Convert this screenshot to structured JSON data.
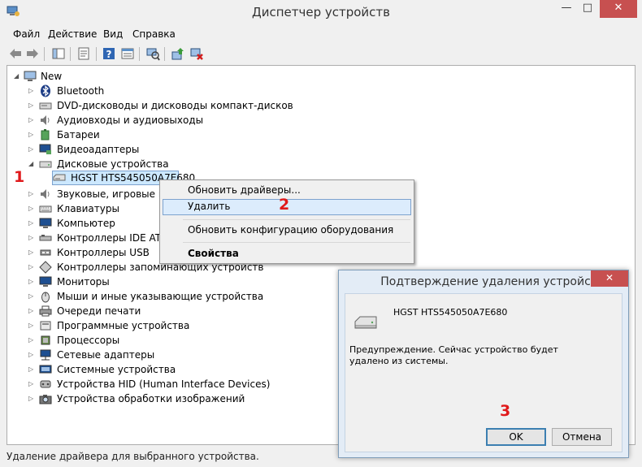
{
  "window": {
    "title": "Диспетчер устройств",
    "buttons": {
      "minimize": "—",
      "maximize": "□",
      "close": "✕"
    }
  },
  "menu": [
    "Файл",
    "Действие",
    "Вид",
    "Справка"
  ],
  "toolbar": [
    "back-arrow-icon",
    "forward-arrow-icon",
    "show-hide-tree-icon",
    "properties-icon",
    "help-icon",
    "view-icon",
    "scan-hardware-icon",
    "update-driver-icon",
    "uninstall-icon"
  ],
  "tree": {
    "root": "New",
    "items": [
      "Bluetooth",
      "DVD-дисководы и дисководы компакт-дисков",
      "Аудиовходы и аудиовыходы",
      "Батареи",
      "Видеоадаптеры",
      "Дисковые устройства",
      "HGST HTS545050A7E680",
      "Звуковые, игровые и в",
      "Клавиатуры",
      "Компьютер",
      "Контроллеры IDE ATA/",
      "Контроллеры USB",
      "Контроллеры запоминающих устройств",
      "Мониторы",
      "Мыши и иные указывающие устройства",
      "Очереди печати",
      "Программные устройства",
      "Процессоры",
      "Сетевые адаптеры",
      "Системные устройства",
      "Устройства HID (Human Interface Devices)",
      "Устройства обработки изображений"
    ]
  },
  "context_menu": {
    "update_driver": "Обновить драйверы...",
    "delete": "Удалить",
    "scan_hardware": "Обновить конфигурацию оборудования",
    "properties": "Свойства"
  },
  "status_bar": "Удаление драйвера для выбранного устройства.",
  "dialog": {
    "title": "Подтверждение удаления устройства",
    "close": "✕",
    "device_name": "HGST HTS545050A7E680",
    "warning": "Предупреждение. Сейчас устройство будет удалено из системы.",
    "ok": "OK",
    "cancel": "Отмена"
  },
  "markers": {
    "step1": "1",
    "step2": "2",
    "step3": "3"
  },
  "colors": {
    "marker": "#e0191b",
    "selection": "#cce8ff",
    "close_button": "#c75050"
  }
}
